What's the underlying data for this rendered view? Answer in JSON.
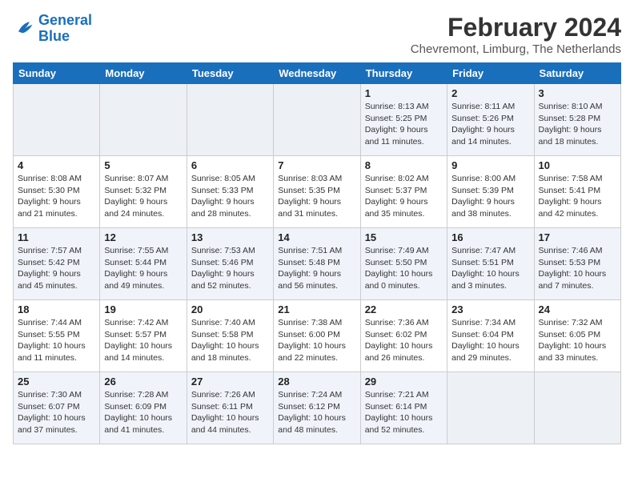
{
  "logo": {
    "line1": "General",
    "line2": "Blue"
  },
  "title": "February 2024",
  "location": "Chevremont, Limburg, The Netherlands",
  "days_of_week": [
    "Sunday",
    "Monday",
    "Tuesday",
    "Wednesday",
    "Thursday",
    "Friday",
    "Saturday"
  ],
  "weeks": [
    [
      {
        "day": "",
        "sunrise": "",
        "sunset": "",
        "daylight": ""
      },
      {
        "day": "",
        "sunrise": "",
        "sunset": "",
        "daylight": ""
      },
      {
        "day": "",
        "sunrise": "",
        "sunset": "",
        "daylight": ""
      },
      {
        "day": "",
        "sunrise": "",
        "sunset": "",
        "daylight": ""
      },
      {
        "day": "1",
        "sunrise": "Sunrise: 8:13 AM",
        "sunset": "Sunset: 5:25 PM",
        "daylight": "Daylight: 9 hours and 11 minutes."
      },
      {
        "day": "2",
        "sunrise": "Sunrise: 8:11 AM",
        "sunset": "Sunset: 5:26 PM",
        "daylight": "Daylight: 9 hours and 14 minutes."
      },
      {
        "day": "3",
        "sunrise": "Sunrise: 8:10 AM",
        "sunset": "Sunset: 5:28 PM",
        "daylight": "Daylight: 9 hours and 18 minutes."
      }
    ],
    [
      {
        "day": "4",
        "sunrise": "Sunrise: 8:08 AM",
        "sunset": "Sunset: 5:30 PM",
        "daylight": "Daylight: 9 hours and 21 minutes."
      },
      {
        "day": "5",
        "sunrise": "Sunrise: 8:07 AM",
        "sunset": "Sunset: 5:32 PM",
        "daylight": "Daylight: 9 hours and 24 minutes."
      },
      {
        "day": "6",
        "sunrise": "Sunrise: 8:05 AM",
        "sunset": "Sunset: 5:33 PM",
        "daylight": "Daylight: 9 hours and 28 minutes."
      },
      {
        "day": "7",
        "sunrise": "Sunrise: 8:03 AM",
        "sunset": "Sunset: 5:35 PM",
        "daylight": "Daylight: 9 hours and 31 minutes."
      },
      {
        "day": "8",
        "sunrise": "Sunrise: 8:02 AM",
        "sunset": "Sunset: 5:37 PM",
        "daylight": "Daylight: 9 hours and 35 minutes."
      },
      {
        "day": "9",
        "sunrise": "Sunrise: 8:00 AM",
        "sunset": "Sunset: 5:39 PM",
        "daylight": "Daylight: 9 hours and 38 minutes."
      },
      {
        "day": "10",
        "sunrise": "Sunrise: 7:58 AM",
        "sunset": "Sunset: 5:41 PM",
        "daylight": "Daylight: 9 hours and 42 minutes."
      }
    ],
    [
      {
        "day": "11",
        "sunrise": "Sunrise: 7:57 AM",
        "sunset": "Sunset: 5:42 PM",
        "daylight": "Daylight: 9 hours and 45 minutes."
      },
      {
        "day": "12",
        "sunrise": "Sunrise: 7:55 AM",
        "sunset": "Sunset: 5:44 PM",
        "daylight": "Daylight: 9 hours and 49 minutes."
      },
      {
        "day": "13",
        "sunrise": "Sunrise: 7:53 AM",
        "sunset": "Sunset: 5:46 PM",
        "daylight": "Daylight: 9 hours and 52 minutes."
      },
      {
        "day": "14",
        "sunrise": "Sunrise: 7:51 AM",
        "sunset": "Sunset: 5:48 PM",
        "daylight": "Daylight: 9 hours and 56 minutes."
      },
      {
        "day": "15",
        "sunrise": "Sunrise: 7:49 AM",
        "sunset": "Sunset: 5:50 PM",
        "daylight": "Daylight: 10 hours and 0 minutes."
      },
      {
        "day": "16",
        "sunrise": "Sunrise: 7:47 AM",
        "sunset": "Sunset: 5:51 PM",
        "daylight": "Daylight: 10 hours and 3 minutes."
      },
      {
        "day": "17",
        "sunrise": "Sunrise: 7:46 AM",
        "sunset": "Sunset: 5:53 PM",
        "daylight": "Daylight: 10 hours and 7 minutes."
      }
    ],
    [
      {
        "day": "18",
        "sunrise": "Sunrise: 7:44 AM",
        "sunset": "Sunset: 5:55 PM",
        "daylight": "Daylight: 10 hours and 11 minutes."
      },
      {
        "day": "19",
        "sunrise": "Sunrise: 7:42 AM",
        "sunset": "Sunset: 5:57 PM",
        "daylight": "Daylight: 10 hours and 14 minutes."
      },
      {
        "day": "20",
        "sunrise": "Sunrise: 7:40 AM",
        "sunset": "Sunset: 5:58 PM",
        "daylight": "Daylight: 10 hours and 18 minutes."
      },
      {
        "day": "21",
        "sunrise": "Sunrise: 7:38 AM",
        "sunset": "Sunset: 6:00 PM",
        "daylight": "Daylight: 10 hours and 22 minutes."
      },
      {
        "day": "22",
        "sunrise": "Sunrise: 7:36 AM",
        "sunset": "Sunset: 6:02 PM",
        "daylight": "Daylight: 10 hours and 26 minutes."
      },
      {
        "day": "23",
        "sunrise": "Sunrise: 7:34 AM",
        "sunset": "Sunset: 6:04 PM",
        "daylight": "Daylight: 10 hours and 29 minutes."
      },
      {
        "day": "24",
        "sunrise": "Sunrise: 7:32 AM",
        "sunset": "Sunset: 6:05 PM",
        "daylight": "Daylight: 10 hours and 33 minutes."
      }
    ],
    [
      {
        "day": "25",
        "sunrise": "Sunrise: 7:30 AM",
        "sunset": "Sunset: 6:07 PM",
        "daylight": "Daylight: 10 hours and 37 minutes."
      },
      {
        "day": "26",
        "sunrise": "Sunrise: 7:28 AM",
        "sunset": "Sunset: 6:09 PM",
        "daylight": "Daylight: 10 hours and 41 minutes."
      },
      {
        "day": "27",
        "sunrise": "Sunrise: 7:26 AM",
        "sunset": "Sunset: 6:11 PM",
        "daylight": "Daylight: 10 hours and 44 minutes."
      },
      {
        "day": "28",
        "sunrise": "Sunrise: 7:24 AM",
        "sunset": "Sunset: 6:12 PM",
        "daylight": "Daylight: 10 hours and 48 minutes."
      },
      {
        "day": "29",
        "sunrise": "Sunrise: 7:21 AM",
        "sunset": "Sunset: 6:14 PM",
        "daylight": "Daylight: 10 hours and 52 minutes."
      },
      {
        "day": "",
        "sunrise": "",
        "sunset": "",
        "daylight": ""
      },
      {
        "day": "",
        "sunrise": "",
        "sunset": "",
        "daylight": ""
      }
    ]
  ]
}
